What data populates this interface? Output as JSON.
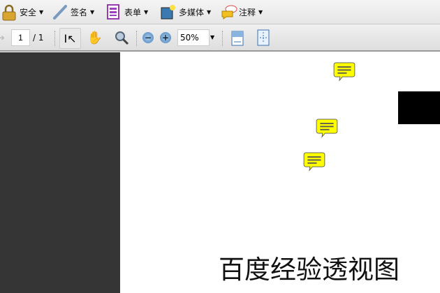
{
  "menu": [
    {
      "label": "安全",
      "icon": "lock-icon"
    },
    {
      "label": "签名",
      "icon": "pen-icon"
    },
    {
      "label": "表单",
      "icon": "form-icon"
    },
    {
      "label": "多媒体",
      "icon": "multimedia-icon"
    },
    {
      "label": "注释",
      "icon": "comment-icon"
    }
  ],
  "nav": {
    "page_current": "1",
    "page_total": "/ 1",
    "zoom": "50%"
  },
  "notes": [
    "comment-note-icon",
    "comment-note-icon",
    "comment-note-icon"
  ],
  "document": {
    "title": "百度经验透视图"
  }
}
